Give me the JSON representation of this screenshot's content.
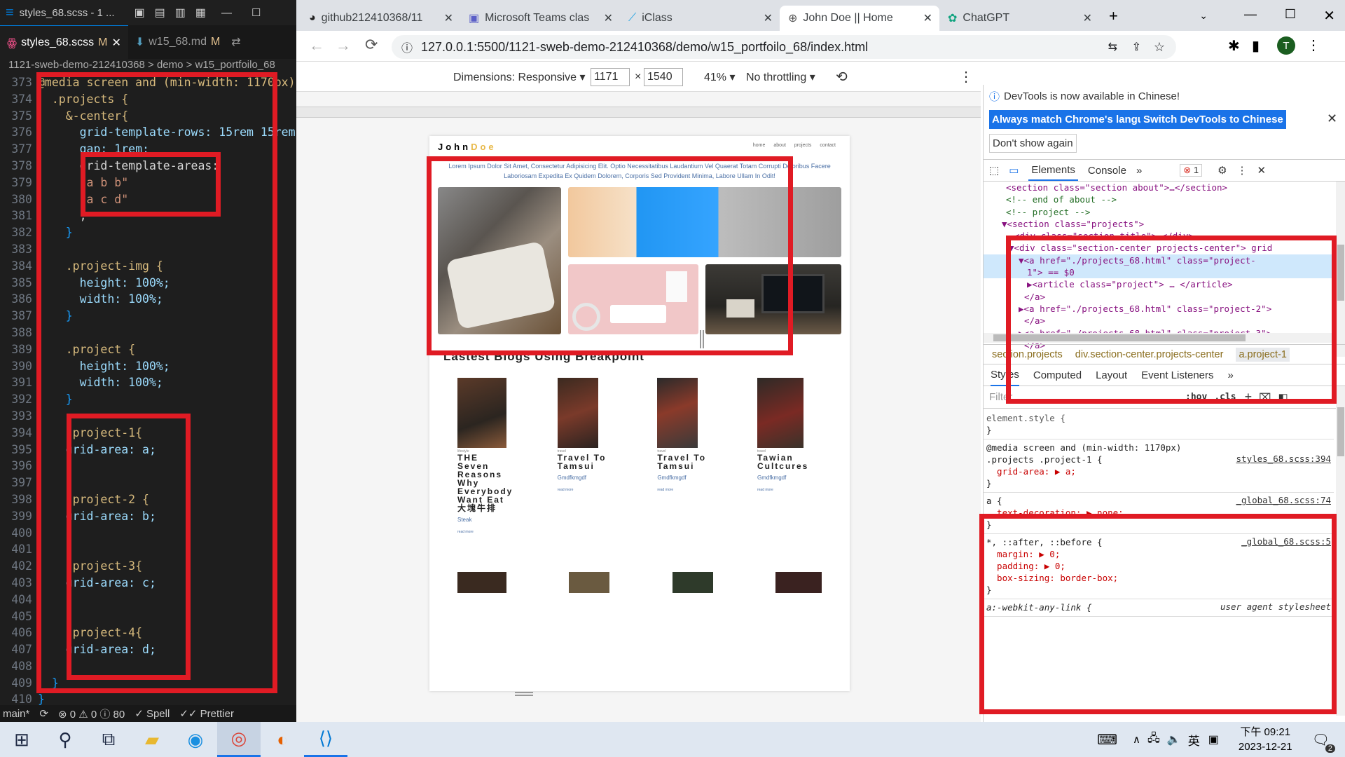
{
  "vscode": {
    "title": "styles_68.scss - 1 ...",
    "tabs": [
      {
        "label": "styles_68.scss",
        "mod": "M"
      },
      {
        "label": "w15_68.md",
        "mod": "M"
      }
    ],
    "breadcrumb": "1121-sweb-demo-212410368 > demo > w15_portfoilo_68",
    "lines": [
      {
        "n": "373",
        "t": "@media screen and (min-width: 1170px) {"
      },
      {
        "n": "374",
        "t": "  .projects {"
      },
      {
        "n": "375",
        "t": "    &-center{"
      },
      {
        "n": "376",
        "t": "      grid-template-rows: 15rem 15rem;"
      },
      {
        "n": "377",
        "t": "      gap: 1rem;"
      },
      {
        "n": "378",
        "t": "      grid-template-areas:"
      },
      {
        "n": "379",
        "t": "      \"a b b\""
      },
      {
        "n": "380",
        "t": "      \"a c d\""
      },
      {
        "n": "381",
        "t": "      ;"
      },
      {
        "n": "382",
        "t": "    }"
      },
      {
        "n": "383",
        "t": ""
      },
      {
        "n": "384",
        "t": "    .project-img {"
      },
      {
        "n": "385",
        "t": "      height: 100%;"
      },
      {
        "n": "386",
        "t": "      width: 100%;"
      },
      {
        "n": "387",
        "t": "    }"
      },
      {
        "n": "388",
        "t": ""
      },
      {
        "n": "389",
        "t": "    .project {"
      },
      {
        "n": "390",
        "t": "      height: 100%;"
      },
      {
        "n": "391",
        "t": "      width: 100%;"
      },
      {
        "n": "392",
        "t": "    }"
      },
      {
        "n": "393",
        "t": ""
      },
      {
        "n": "394",
        "t": "    .project-1{"
      },
      {
        "n": "395",
        "t": "    grid-area: a;"
      },
      {
        "n": "396",
        "t": "    }"
      },
      {
        "n": "397",
        "t": ""
      },
      {
        "n": "398",
        "t": "    .project-2 {"
      },
      {
        "n": "399",
        "t": "    grid-area: b;"
      },
      {
        "n": "400",
        "t": "    }"
      },
      {
        "n": "401",
        "t": ""
      },
      {
        "n": "402",
        "t": "    .project-3{"
      },
      {
        "n": "403",
        "t": "    grid-area: c;"
      },
      {
        "n": "404",
        "t": "    }"
      },
      {
        "n": "405",
        "t": ""
      },
      {
        "n": "406",
        "t": "    .project-4{"
      },
      {
        "n": "407",
        "t": "    grid-area: d;"
      },
      {
        "n": "408",
        "t": "    }"
      },
      {
        "n": "409",
        "t": "  }"
      },
      {
        "n": "410",
        "t": "}"
      }
    ],
    "status": {
      "branch": "main*",
      "errors": "0",
      "warnings": "0",
      "info": "80",
      "spell": "Spell",
      "prettier": "Prettier"
    }
  },
  "chrome": {
    "tabs": [
      {
        "label": "github212410368/11",
        "icon": "github-icon"
      },
      {
        "label": "Microsoft Teams clas",
        "icon": "teams-icon"
      },
      {
        "label": "iClass",
        "icon": "iclass-icon"
      },
      {
        "label": "John Doe || Home",
        "icon": "globe-icon",
        "active": true
      },
      {
        "label": "ChatGPT",
        "icon": "chatgpt-icon"
      }
    ],
    "url": "127.0.0.1:5500/1121-sweb-demo-212410368/demo/w15_portfoilo_68/index.html",
    "profile": "T",
    "device": {
      "dimensions": "Dimensions: Responsive",
      "width": "1171",
      "height": "1540",
      "zoom": "41%",
      "throttle": "No throttling"
    }
  },
  "site": {
    "logo_first": "John",
    "logo_second": "Doe",
    "nav": [
      "home",
      "about",
      "projects",
      "contact"
    ],
    "intro": "Lorem Ipsum Dolor Sit Amet, Consectetur Adipisicing Elit. Optio Necessitatibus Laudantium Vel Quaerat Totam Corrupti Doloribus Facere Laboriosam Expedita Ex Quidem Dolorem, Corporis Sed Provident Minima, Labore Ullam In Odit!",
    "blogs_title": "Lastest Blogs Using Breakpoint",
    "blogs": [
      {
        "cat": "lifestyle",
        "title": "THE Seven Reasons Why Everybody Want Eat 大塊牛排",
        "sub": "Steak",
        "more": "read more"
      },
      {
        "cat": "travel",
        "title": "Travel To Tamsui",
        "sub": "Gmdfkmgdf",
        "more": "read more"
      },
      {
        "cat": "travel",
        "title": "Travel To Tamsui",
        "sub": "Gmdfkmgdf",
        "more": "read more"
      },
      {
        "cat": "travel",
        "title": "Tawian Cultcures",
        "sub": "Gmdfkmgdf",
        "more": "read more"
      }
    ]
  },
  "devtools": {
    "banner": "DevTools is now available in Chinese!",
    "btn_match": "Always match Chrome's language",
    "btn_switch": "Switch DevTools to Chinese",
    "btn_dont": "Don't show again",
    "tabs": [
      "Elements",
      "Console"
    ],
    "error_count": "1",
    "dom": [
      "<section class=\"section about\">…</section>",
      "<!-- end of about -->",
      "<!-- project -->",
      "▼<section class=\"projects\">",
      "<div class=\"section-title\">…</div>",
      "▼<div class=\"section-center projects-center\"> grid",
      "▼<a href=\"./projects_68.html\" class=\"project-",
      "1\"> == $0",
      "▶<article class=\"project\"> … </article>",
      "</a>",
      "▶<a href=\"./projects_68.html\" class=\"project-2\">",
      "</a>",
      "▶<a href=\"./projects_68.html\" class=\"project-3\">",
      "</a>",
      "▶<a href=\"./projects_68.html\" class=\"project-4\">"
    ],
    "crumbs": [
      "section.projects",
      "div.section-center.projects-center",
      "a.project-1"
    ],
    "style_tabs": [
      "Styles",
      "Computed",
      "Layout",
      "Event Listeners"
    ],
    "filter": "Filter",
    "hov": ":hov",
    "cls": ".cls",
    "rules": [
      {
        "sel": "element.style {",
        "lines": [
          "}"
        ],
        "src": ""
      },
      {
        "sel": "@media screen and (min-width: 1170px)",
        "lines": [
          ".projects .project-1 {",
          "  grid-area: ▶ a;",
          "}"
        ],
        "src": "styles_68.scss:394"
      },
      {
        "sel": "a {",
        "lines": [
          "  text-decoration: ▶ none;",
          "}"
        ],
        "src": "_global_68.scss:74"
      },
      {
        "sel": "*, ::after, ::before {",
        "lines": [
          "  margin: ▶ 0;",
          "  padding: ▶ 0;",
          "  box-sizing: border-box;",
          "}"
        ],
        "src": "_global_68.scss:5"
      },
      {
        "sel": "a:-webkit-any-link {",
        "lines": [],
        "src": "user agent stylesheet"
      }
    ]
  },
  "taskbar": {
    "time": "下午 09:21",
    "date": "2023-12-21",
    "lang": "英",
    "notif": "2"
  }
}
